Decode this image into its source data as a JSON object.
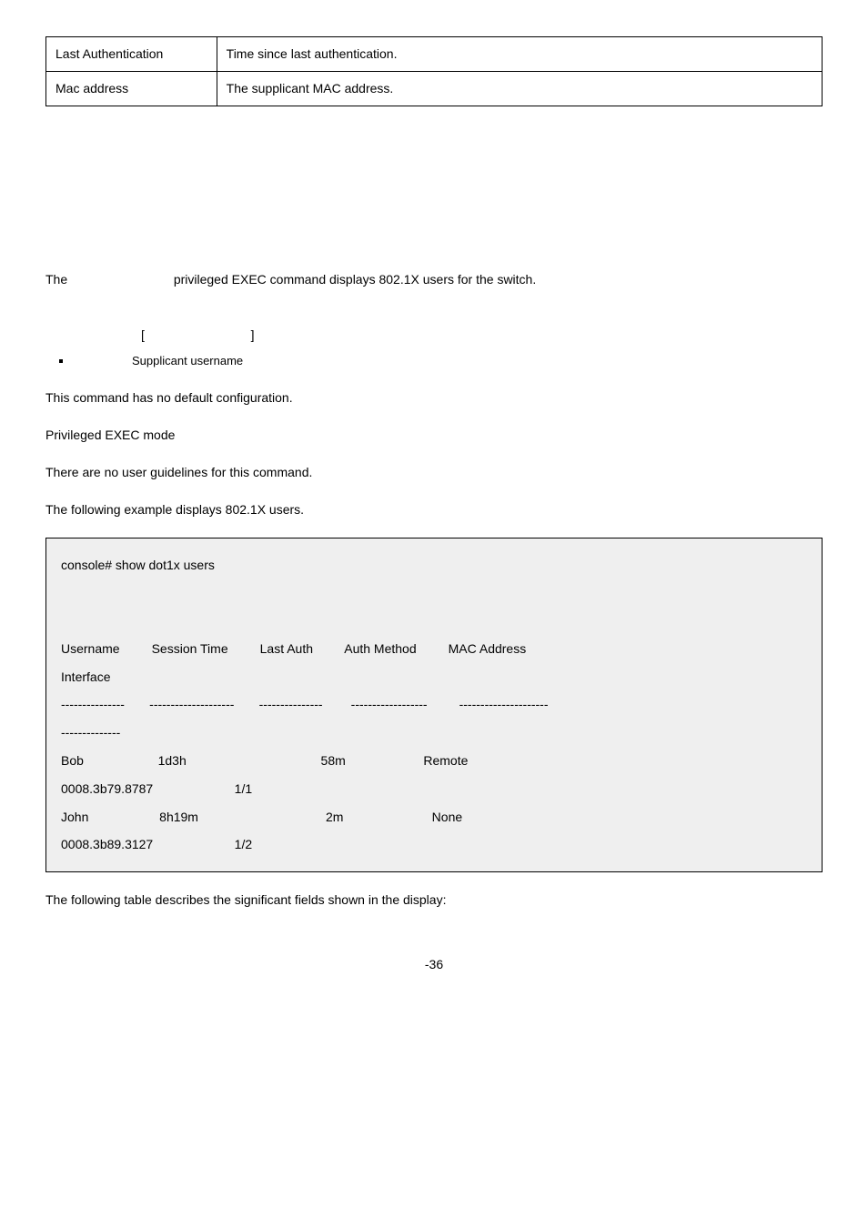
{
  "definition_table": {
    "rows": [
      {
        "label": "Last Authentication",
        "desc": "Time since last authentication."
      },
      {
        "label": "Mac address",
        "desc": "The supplicant MAC address."
      }
    ]
  },
  "intro": {
    "prefix": "The",
    "rest": "privileged EXEC command displays 802.1X users for the switch."
  },
  "syntax": {
    "open_bracket": "[",
    "close_bracket": "]",
    "bullet_text": "Supplicant username"
  },
  "default_cfg": "This command has no default configuration.",
  "command_mode": "Privileged EXEC mode",
  "user_guidelines": "There are no user guidelines for this command.",
  "example_intro": "The following example displays 802.1X users.",
  "example_text": "console# show dot1x users\n\n\nUsername         Session Time         Last Auth         Auth Method         MAC Address\nInterface\n---------------       --------------------       ---------------        ------------------         ---------------------\n--------------\nBob                     1d3h                                      58m                      Remote\n0008.3b79.8787                       1/1\nJohn                    8h19m                                    2m                         None\n0008.3b89.3127                       1/2",
  "footer_text": "The following table describes the significant fields shown in the display:",
  "page_number": "-36",
  "chart_data": {
    "type": "table",
    "columns": [
      "Username",
      "Session Time",
      "Last Auth",
      "Auth Method",
      "MAC Address",
      "Interface"
    ],
    "rows": [
      {
        "Username": "Bob",
        "Session Time": "1d3h",
        "Last Auth": "58m",
        "Auth Method": "Remote",
        "MAC Address": "0008.3b79.8787",
        "Interface": "1/1"
      },
      {
        "Username": "John",
        "Session Time": "8h19m",
        "Last Auth": "2m",
        "Auth Method": "None",
        "MAC Address": "0008.3b89.3127",
        "Interface": "1/2"
      }
    ]
  }
}
